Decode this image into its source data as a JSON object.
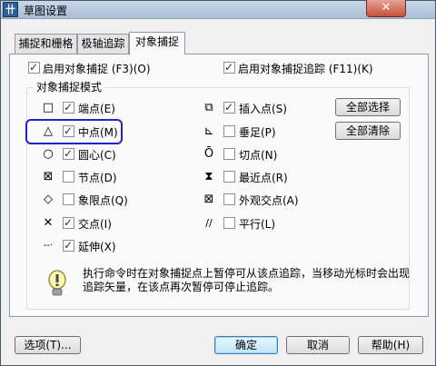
{
  "window": {
    "title": "草图设置",
    "app_icon": "drafting-icon",
    "close_glyph": "✕"
  },
  "tabs": [
    {
      "label": "捕捉和栅格",
      "active": false
    },
    {
      "label": "极轴追踪",
      "active": false
    },
    {
      "label": "对象捕捉",
      "active": true
    }
  ],
  "top_options": {
    "enable_osnap": {
      "label": "启用对象捕捉 (F3)(O)",
      "checked": true
    },
    "enable_tracking": {
      "label": "启用对象捕捉追踪 (F11)(K)",
      "checked": true
    }
  },
  "group_title": "对象捕捉模式",
  "modes_left": [
    {
      "symbol": "□",
      "icon": "square-icon",
      "label": "端点(E)",
      "checked": true
    },
    {
      "symbol": "△",
      "icon": "triangle-icon",
      "label": "中点(M)",
      "checked": true
    },
    {
      "symbol": "○",
      "icon": "circle-icon",
      "label": "圆心(C)",
      "checked": true
    },
    {
      "symbol": "⊠",
      "icon": "node-icon",
      "label": "节点(D)",
      "checked": false
    },
    {
      "symbol": "◇",
      "icon": "diamond-icon",
      "label": "象限点(Q)",
      "checked": false
    },
    {
      "symbol": "✕",
      "icon": "cross-icon",
      "label": "交点(I)",
      "checked": true
    },
    {
      "symbol": "‐‐·",
      "icon": "extension-icon",
      "label": "延伸(X)",
      "checked": true
    }
  ],
  "modes_right": [
    {
      "symbol": "⧉",
      "icon": "insert-icon",
      "label": "插入点(S)",
      "checked": true
    },
    {
      "symbol": "⊾",
      "icon": "perpendicular-icon",
      "label": "垂足(P)",
      "checked": false
    },
    {
      "symbol": "Ō",
      "icon": "tangent-icon",
      "label": "切点(N)",
      "checked": false
    },
    {
      "symbol": "⧗",
      "icon": "nearest-icon",
      "label": "最近点(R)",
      "checked": false
    },
    {
      "symbol": "⊠",
      "icon": "apparent-intersection-icon",
      "label": "外观交点(A)",
      "checked": false
    },
    {
      "symbol": "∕∕",
      "icon": "parallel-icon",
      "label": "平行(L)",
      "checked": false
    }
  ],
  "side_buttons": {
    "select_all": "全部选择",
    "clear_all": "全部清除"
  },
  "info_text": "执行命令时在对象捕捉点上暂停可从该点追踪，当移动光标时会出现追踪矢量，在该点再次暂停可停止追踪。",
  "info_icon": "lightbulb-icon",
  "footer": {
    "options": "选项(T)...",
    "ok": "确定",
    "cancel": "取消",
    "help": "帮助(H)"
  }
}
